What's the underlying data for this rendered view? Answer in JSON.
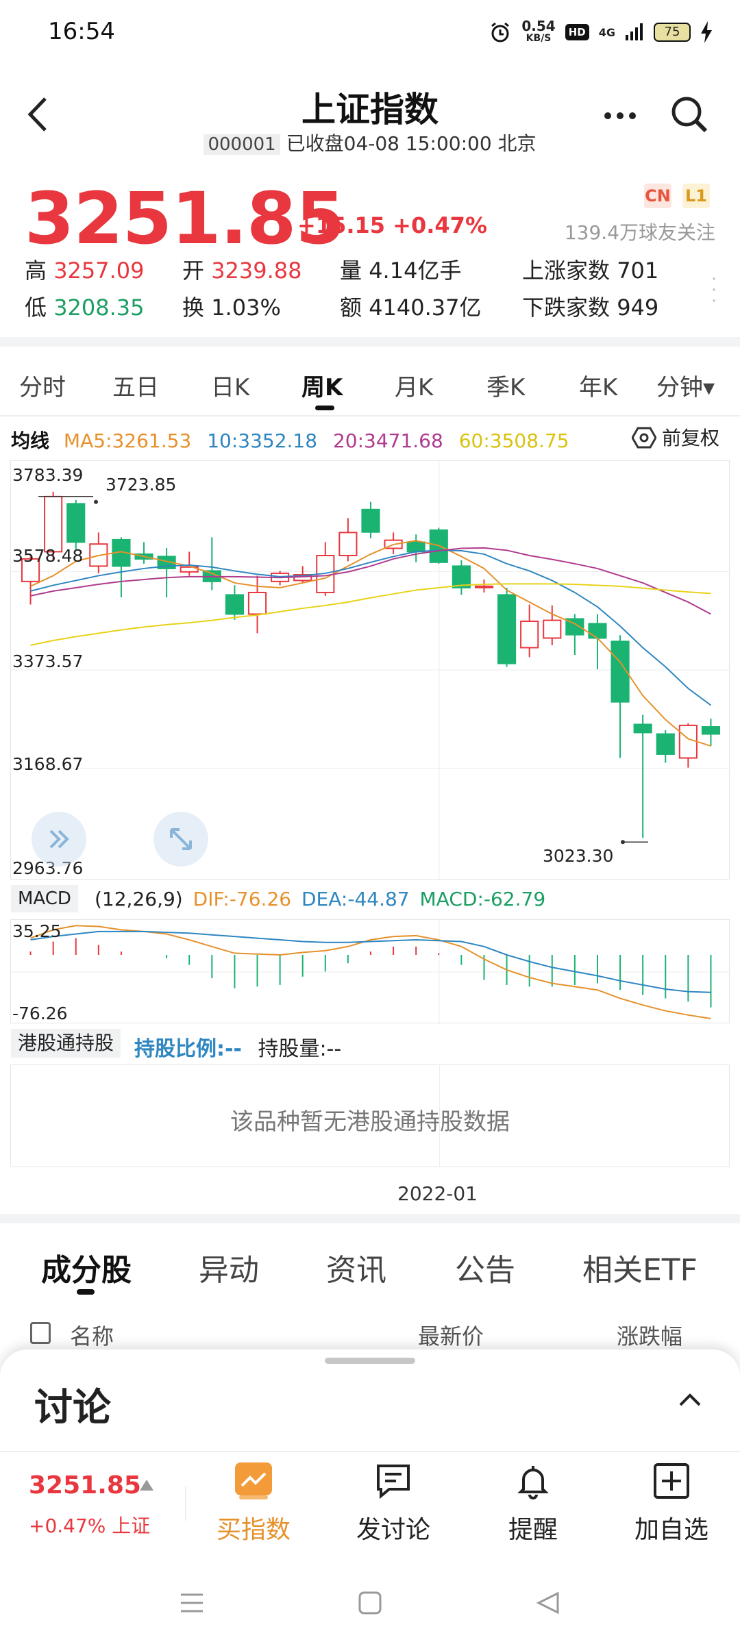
{
  "status": {
    "time": "16:54",
    "net_speed": "0.54",
    "net_unit": "KB/S",
    "hd": "HD",
    "signal": "4G",
    "battery": "75"
  },
  "header": {
    "title": "上证指数",
    "code": "000001",
    "status_text": "已收盘04-08 15:00:00 北京"
  },
  "quote": {
    "price": "3251.85",
    "change": "+15.15",
    "change_pct": "+0.47%",
    "badge_cn": "CN",
    "badge_l1": "L1",
    "followers": "139.4万球友关注",
    "high_label": "高",
    "high": "3257.09",
    "open_label": "开",
    "open": "3239.88",
    "volume_label": "量",
    "volume": "4.14亿手",
    "up_label": "上涨家数",
    "up_count": "701",
    "low_label": "低",
    "low": "3208.35",
    "turnover_label": "换",
    "turnover": "1.03%",
    "amount_label": "额",
    "amount": "4140.37亿",
    "down_label": "下跌家数",
    "down_count": "949"
  },
  "tabs": [
    "分时",
    "五日",
    "日K",
    "周K",
    "月K",
    "季K",
    "年K",
    "分钟▾"
  ],
  "active_tab": "周K",
  "ma": {
    "label": "均线",
    "ma5": "MA5:3261.53",
    "ma10": "10:3352.18",
    "ma20": "20:3471.68",
    "ma60": "60:3508.75",
    "adjust": "前复权"
  },
  "colors": {
    "up": "#e8373e",
    "down": "#1ab372",
    "ma5": "#e6912b",
    "ma10": "#2e86c1",
    "ma20": "#b03a8e",
    "ma60": "#e8d21a"
  },
  "kline": {
    "y_ticks": [
      "3783.39",
      "3578.48",
      "3373.57",
      "3168.67",
      "2963.76"
    ],
    "max_label": "3723.85",
    "min_label": "3023.30",
    "x_label": "2022-01"
  },
  "chart_data": {
    "type": "candlestick",
    "ylim": [
      2963.76,
      3783.39
    ],
    "candles": [
      {
        "o": 3558,
        "c": 3605,
        "h": 3610,
        "l": 3510
      },
      {
        "o": 3620,
        "c": 3735,
        "h": 3745,
        "l": 3600
      },
      {
        "o": 3720,
        "c": 3640,
        "h": 3728,
        "l": 3625
      },
      {
        "o": 3590,
        "c": 3636,
        "h": 3660,
        "l": 3575
      },
      {
        "o": 3645,
        "c": 3590,
        "h": 3650,
        "l": 3525
      },
      {
        "o": 3615,
        "c": 3605,
        "h": 3640,
        "l": 3595
      },
      {
        "o": 3610,
        "c": 3585,
        "h": 3628,
        "l": 3525
      },
      {
        "o": 3578,
        "c": 3588,
        "h": 3620,
        "l": 3570
      },
      {
        "o": 3580,
        "c": 3558,
        "h": 3650,
        "l": 3540
      },
      {
        "o": 3530,
        "c": 3490,
        "h": 3550,
        "l": 3478
      },
      {
        "o": 3490,
        "c": 3535,
        "h": 3570,
        "l": 3450
      },
      {
        "o": 3558,
        "c": 3575,
        "h": 3580,
        "l": 3550
      },
      {
        "o": 3560,
        "c": 3572,
        "h": 3590,
        "l": 3555
      },
      {
        "o": 3535,
        "c": 3612,
        "h": 3640,
        "l": 3528
      },
      {
        "o": 3612,
        "c": 3660,
        "h": 3690,
        "l": 3600
      },
      {
        "o": 3708,
        "c": 3661,
        "h": 3723.85,
        "l": 3648
      },
      {
        "o": 3627,
        "c": 3644,
        "h": 3660,
        "l": 3615
      },
      {
        "o": 3640,
        "c": 3620,
        "h": 3656,
        "l": 3598
      },
      {
        "o": 3665,
        "c": 3598,
        "h": 3670,
        "l": 3595
      },
      {
        "o": 3590,
        "c": 3545,
        "h": 3602,
        "l": 3530
      },
      {
        "o": 3548,
        "c": 3548,
        "h": 3562,
        "l": 3535
      },
      {
        "o": 3530,
        "c": 3387,
        "h": 3545,
        "l": 3380
      },
      {
        "o": 3420,
        "c": 3475,
        "h": 3510,
        "l": 3400
      },
      {
        "o": 3440,
        "c": 3477,
        "h": 3508,
        "l": 3425
      },
      {
        "o": 3480,
        "c": 3447,
        "h": 3490,
        "l": 3405
      },
      {
        "o": 3470,
        "c": 3440,
        "h": 3490,
        "l": 3375
      },
      {
        "o": 3433,
        "c": 3307,
        "h": 3446,
        "l": 3190
      },
      {
        "o": 3260,
        "c": 3243,
        "h": 3280,
        "l": 3023.3
      },
      {
        "o": 3240,
        "c": 3198,
        "h": 3248,
        "l": 3180
      },
      {
        "o": 3190,
        "c": 3258,
        "h": 3262,
        "l": 3170
      },
      {
        "o": 3255,
        "c": 3240,
        "h": 3272,
        "l": 3215
      }
    ],
    "ma5": [
      3548,
      3570,
      3600,
      3612,
      3620,
      3610,
      3600,
      3590,
      3575,
      3555,
      3548,
      3545,
      3555,
      3565,
      3590,
      3615,
      3635,
      3643,
      3633,
      3610,
      3585,
      3540,
      3515,
      3490,
      3470,
      3440,
      3390,
      3320,
      3270,
      3230,
      3215
    ],
    "ma10": [
      3538,
      3550,
      3560,
      3570,
      3578,
      3585,
      3590,
      3592,
      3588,
      3580,
      3573,
      3568,
      3570,
      3575,
      3585,
      3598,
      3610,
      3620,
      3623,
      3622,
      3615,
      3595,
      3580,
      3560,
      3535,
      3505,
      3465,
      3420,
      3380,
      3335,
      3300
    ],
    "ma20": [
      3528,
      3538,
      3545,
      3552,
      3558,
      3562,
      3566,
      3568,
      3568,
      3568,
      3567,
      3566,
      3568,
      3570,
      3578,
      3590,
      3605,
      3615,
      3622,
      3627,
      3628,
      3623,
      3612,
      3604,
      3595,
      3585,
      3570,
      3555,
      3535,
      3515,
      3490
    ],
    "ma60": [
      3425,
      3435,
      3443,
      3450,
      3457,
      3463,
      3468,
      3472,
      3477,
      3483,
      3488,
      3495,
      3502,
      3508,
      3515,
      3524,
      3532,
      3540,
      3545,
      3550,
      3552,
      3553,
      3553,
      3553,
      3552,
      3550,
      3548,
      3544,
      3540,
      3536,
      3533
    ]
  },
  "macd": {
    "tag": "MACD",
    "params": "(12,26,9)",
    "dif": "DIF:-76.26",
    "dea": "DEA:-44.87",
    "macd": "MACD:-62.79",
    "y_top": "35.25",
    "y_bottom": "-76.26",
    "dif_series": [
      20,
      30,
      35,
      34,
      30,
      28,
      25,
      18,
      10,
      2,
      1,
      0,
      3,
      5,
      10,
      18,
      22,
      23,
      18,
      10,
      -5,
      -18,
      -27,
      -34,
      -38,
      -42,
      -52,
      -60,
      -67,
      -72,
      -76.26
    ],
    "dea_series": [
      18,
      22,
      25,
      28,
      28,
      28,
      27,
      26,
      24,
      22,
      20,
      18,
      16,
      15,
      15,
      16,
      17,
      18,
      17,
      16,
      10,
      0,
      -8,
      -15,
      -20,
      -25,
      -31,
      -36,
      -41,
      -44,
      -44.87
    ],
    "bar_series": [
      4,
      16,
      20,
      12,
      4,
      0,
      -4,
      -12,
      -28,
      -40,
      -38,
      -36,
      -26,
      -20,
      -10,
      4,
      10,
      10,
      2,
      -12,
      -30,
      -36,
      -38,
      -38,
      -36,
      -34,
      -42,
      -48,
      -52,
      -56,
      -62.79
    ]
  },
  "hk": {
    "tag": "港股通持股",
    "ratio": "持股比例:--",
    "amount": "持股量:--",
    "empty": "该品种暂无港股通持股数据"
  },
  "bottom_tabs": [
    "成分股",
    "异动",
    "资讯",
    "公告",
    "相关ETF"
  ],
  "list_header": {
    "name": "名称",
    "price": "最新价",
    "change": "涨跌幅"
  },
  "discussion": {
    "title": "讨论",
    "price": "3251.85",
    "change": "+0.47% 上证"
  },
  "actions": [
    "买指数",
    "发讨论",
    "提醒",
    "加自选"
  ]
}
